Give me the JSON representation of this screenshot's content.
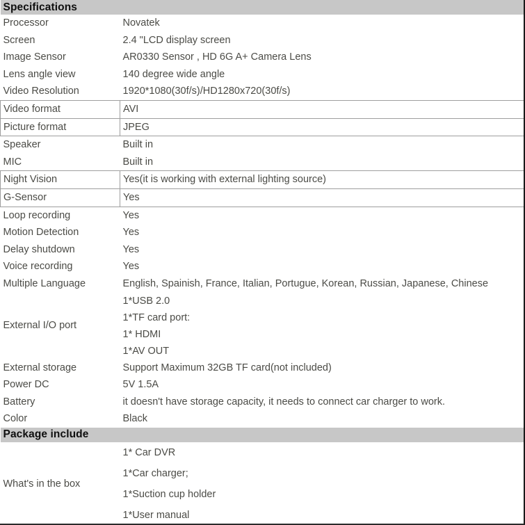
{
  "document": {
    "title": "Specifications",
    "colors": {
      "header_band": "#c7c7c7",
      "text": "#4b4b46",
      "header_text": "#0f0f0f",
      "gridline": "#9e9e9e",
      "frame": "#1a1a1a"
    }
  },
  "sections": [
    {
      "id": "specifications",
      "heading": "Specifications",
      "rows": [
        {
          "label": "Processor",
          "value": "Novatek"
        },
        {
          "label": "Screen",
          "value": "2.4 \"LCD display screen"
        },
        {
          "label": "Image Sensor",
          "value": "AR0330 Sensor , HD 6G A+ Camera Lens"
        },
        {
          "label": "Lens angle view",
          "value": "140 degree wide angle"
        },
        {
          "label": "Video Resolution",
          "value": "1920*1080(30f/s)/HD1280x720(30f/s)"
        },
        {
          "label": "Video format",
          "value": "AVI",
          "bordered": true
        },
        {
          "label": "Picture format",
          "value": "JPEG",
          "bordered": true
        },
        {
          "label": "Speaker",
          "value": "Built in"
        },
        {
          "label": "MIC",
          "value": "Built in"
        },
        {
          "label": "Night Vision",
          "value": "Yes(it is working with external lighting source)",
          "bordered": true
        },
        {
          "label": "G-Sensor",
          "value": "Yes",
          "bordered": true
        },
        {
          "label": "Loop recording",
          "value": "Yes"
        },
        {
          "label": "Motion Detection",
          "value": "Yes"
        },
        {
          "label": "Delay shutdown",
          "value": "Yes"
        },
        {
          "label": "Voice recording",
          "value": "Yes"
        },
        {
          "label": "Multiple Language",
          "value": "English, Spainish, France, Italian, Portugue, Korean, Russian, Japanese, Chinese"
        },
        {
          "label": "External I/O port",
          "lines": [
            "1*USB 2.0",
            "1*TF card port:",
            "1* HDMI",
            "1*AV OUT"
          ]
        },
        {
          "label": "External storage",
          "value": "Support Maximum 32GB TF card(not included)"
        },
        {
          "label": "Power DC",
          "value": "5V 1.5A"
        },
        {
          "label": "Battery",
          "value": "it doesn't have storage capacity, it needs to connect car charger to work."
        },
        {
          "label": "Color",
          "value": "Black"
        }
      ]
    },
    {
      "id": "package-include",
      "heading": "Package include",
      "rows": [
        {
          "label": "What's in the box",
          "lines": [
            "1* Car DVR",
            "1*Car charger;",
            "1*Suction cup holder",
            "1*User manual"
          ]
        }
      ]
    }
  ]
}
